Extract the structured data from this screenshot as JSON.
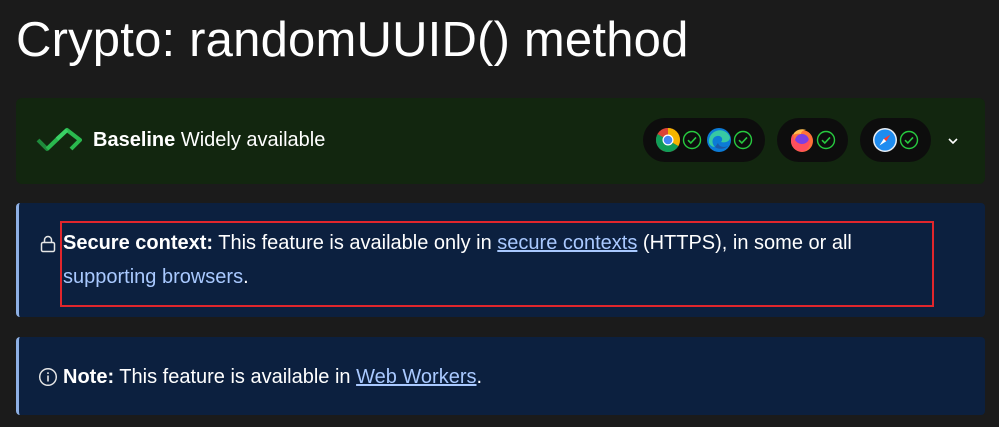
{
  "page": {
    "title": "Crypto: randomUUID() method"
  },
  "baseline": {
    "label_strong": "Baseline",
    "label_rest": " Widely available",
    "browsers": [
      {
        "icon": "chrome-icon",
        "status": "supported"
      },
      {
        "icon": "edge-icon",
        "status": "supported"
      },
      {
        "icon": "firefox-icon",
        "status": "supported"
      },
      {
        "icon": "safari-icon",
        "status": "supported"
      }
    ],
    "colors": {
      "background": "#12260f",
      "check": "#27c93f"
    }
  },
  "secure_notice": {
    "label": "Secure context:",
    "text_before": " This feature is available only in ",
    "link1": "secure contexts",
    "text_middle": " (HTTPS), in some or all",
    "link2": "supporting browsers",
    "text_after": "."
  },
  "note_notice": {
    "label": "Note:",
    "text_before": " This feature is available in ",
    "link": "Web Workers",
    "text_after": "."
  },
  "colors": {
    "page_background": "#1b1b1b",
    "notice_background": "#0c203f",
    "notice_border": "#8eb0e4",
    "link": "#a9c9ff",
    "highlight": "#e1262c"
  }
}
